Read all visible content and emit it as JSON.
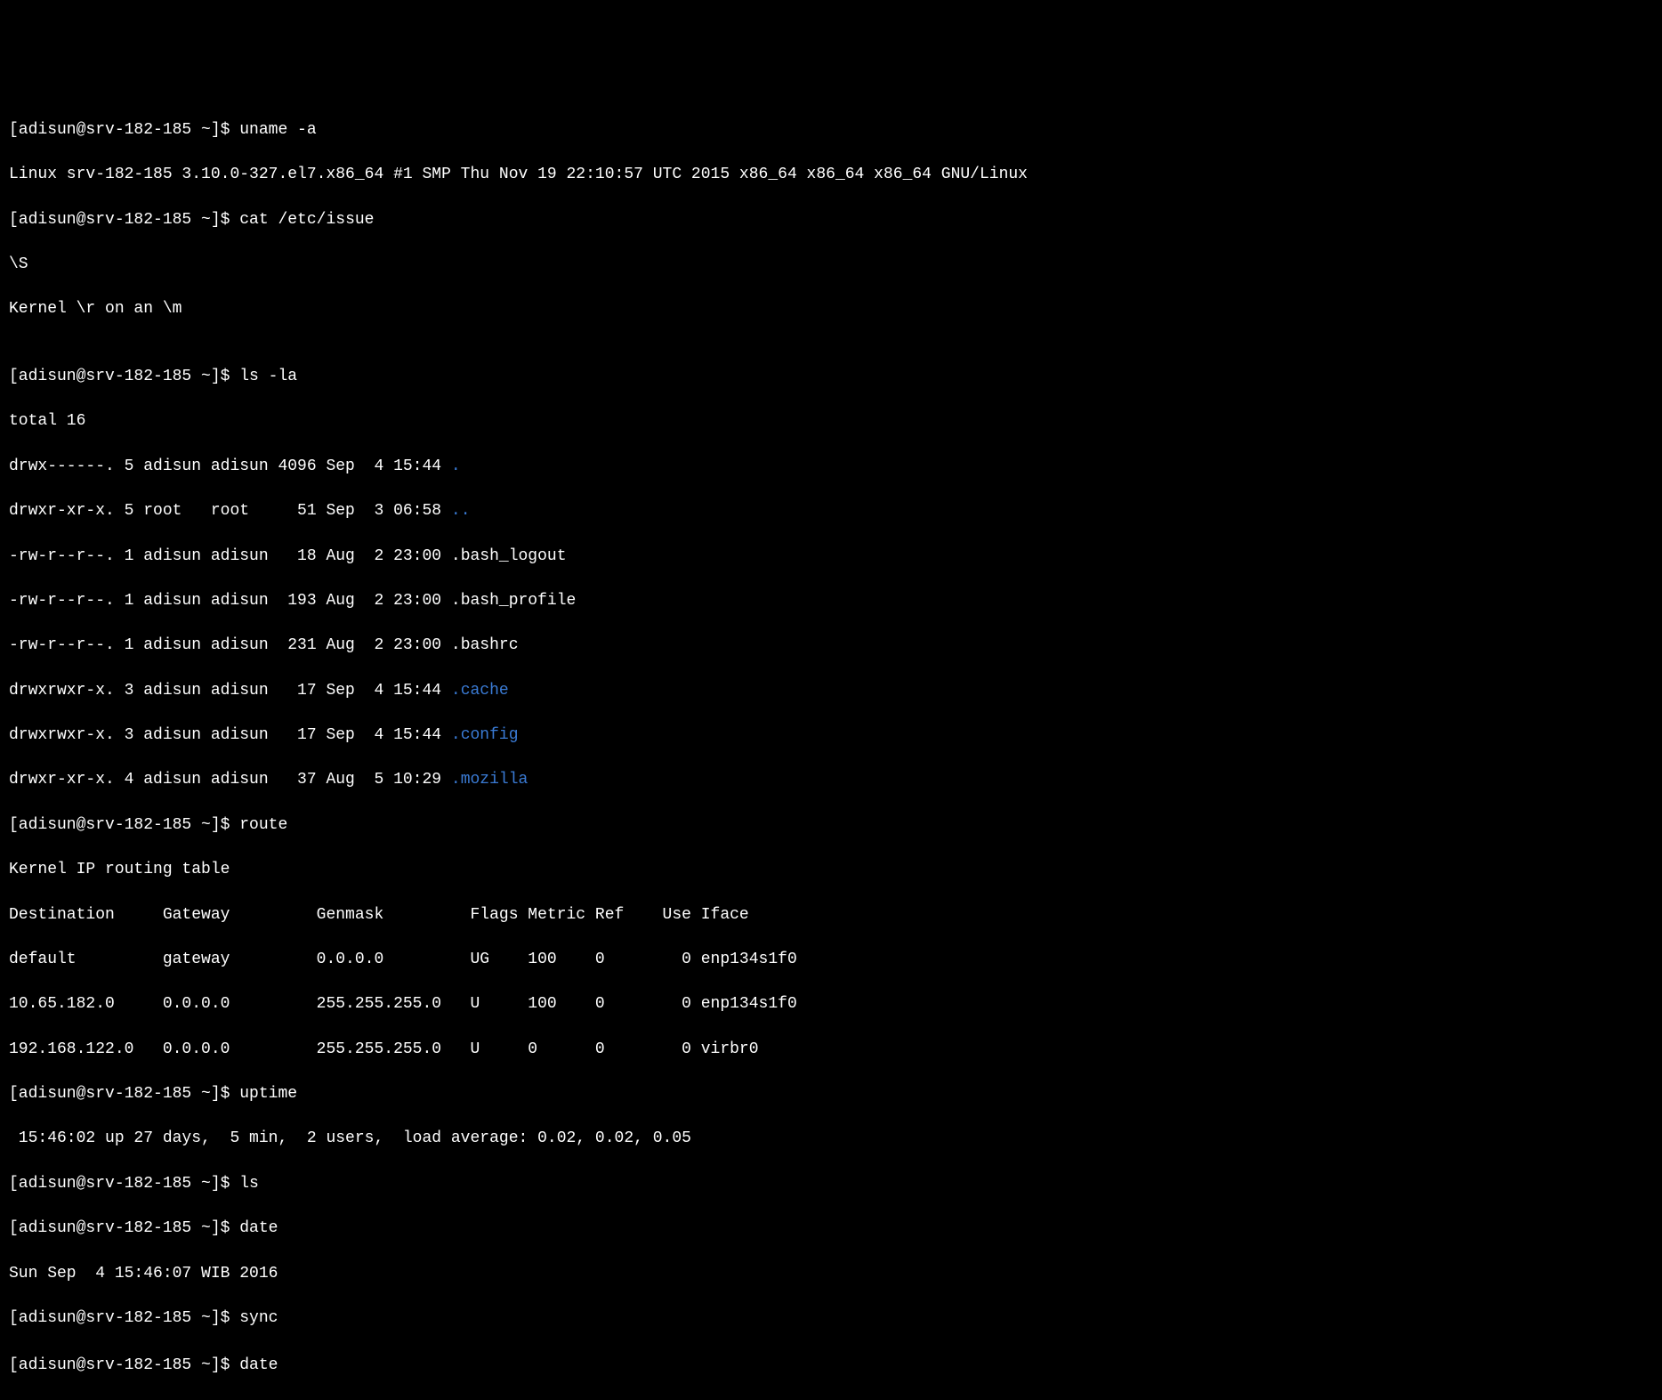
{
  "prompt": "[adisun@srv-182-185 ~]$ ",
  "commands": {
    "uname": "uname -a",
    "cat_issue": "cat /etc/issue",
    "ls_la": "ls -la",
    "route": "route",
    "uptime": "uptime",
    "ls": "ls",
    "date": "date",
    "sync": "sync",
    "date2": "date"
  },
  "output": {
    "uname": "Linux srv-182-185 3.10.0-327.el7.x86_64 #1 SMP Thu Nov 19 22:10:57 UTC 2015 x86_64 x86_64 x86_64 GNU/Linux",
    "cat_issue_line1": "\\S",
    "cat_issue_line2": "Kernel \\r on an \\m",
    "blank": "",
    "ls_total": "total 16",
    "ls_rows": [
      {
        "pre": "drwx------. 5 adisun adisun 4096 Sep  4 15:44 ",
        "name": ".",
        "color": "blue"
      },
      {
        "pre": "drwxr-xr-x. 5 root   root     51 Sep  3 06:58 ",
        "name": "..",
        "color": "blue"
      },
      {
        "pre": "-rw-r--r--. 1 adisun adisun   18 Aug  2 23:00 ",
        "name": ".bash_logout",
        "color": "white"
      },
      {
        "pre": "-rw-r--r--. 1 adisun adisun  193 Aug  2 23:00 ",
        "name": ".bash_profile",
        "color": "white"
      },
      {
        "pre": "-rw-r--r--. 1 adisun adisun  231 Aug  2 23:00 ",
        "name": ".bashrc",
        "color": "white"
      },
      {
        "pre": "drwxrwxr-x. 3 adisun adisun   17 Sep  4 15:44 ",
        "name": ".cache",
        "color": "blue"
      },
      {
        "pre": "drwxrwxr-x. 3 adisun adisun   17 Sep  4 15:44 ",
        "name": ".config",
        "color": "blue"
      },
      {
        "pre": "drwxr-xr-x. 4 adisun adisun   37 Aug  5 10:29 ",
        "name": ".mozilla",
        "color": "blue"
      }
    ],
    "route_title": "Kernel IP routing table",
    "route_header": "Destination     Gateway         Genmask         Flags Metric Ref    Use Iface",
    "route_rows": [
      "default         gateway         0.0.0.0         UG    100    0        0 enp134s1f0",
      "10.65.182.0     0.0.0.0         255.255.255.0   U     100    0        0 enp134s1f0",
      "192.168.122.0   0.0.0.0         255.255.255.0   U     0      0        0 virbr0"
    ],
    "uptime": " 15:46:02 up 27 days,  5 min,  2 users,  load average: 0.02, 0.02, 0.05",
    "date": "Sun Sep  4 15:46:07 WIB 2016"
  }
}
